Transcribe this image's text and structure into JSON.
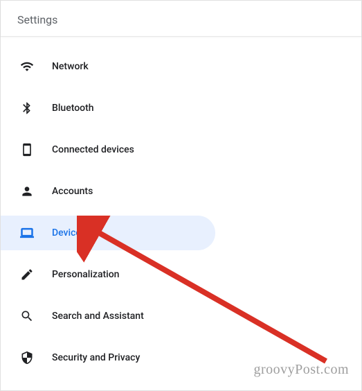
{
  "header": {
    "title": "Settings"
  },
  "nav": {
    "items": [
      {
        "icon": "wifi",
        "label": "Network",
        "selected": false
      },
      {
        "icon": "bluetooth",
        "label": "Bluetooth",
        "selected": false
      },
      {
        "icon": "devices",
        "label": "Connected devices",
        "selected": false
      },
      {
        "icon": "person",
        "label": "Accounts",
        "selected": false
      },
      {
        "icon": "laptop",
        "label": "Device",
        "selected": true
      },
      {
        "icon": "edit",
        "label": "Personalization",
        "selected": false
      },
      {
        "icon": "search",
        "label": "Search and Assistant",
        "selected": false
      },
      {
        "icon": "shield",
        "label": "Security and Privacy",
        "selected": false
      }
    ]
  },
  "watermark": "groovyPost.com",
  "accent_color": "#1a73e8",
  "selected_bg": "#e8f0fe"
}
